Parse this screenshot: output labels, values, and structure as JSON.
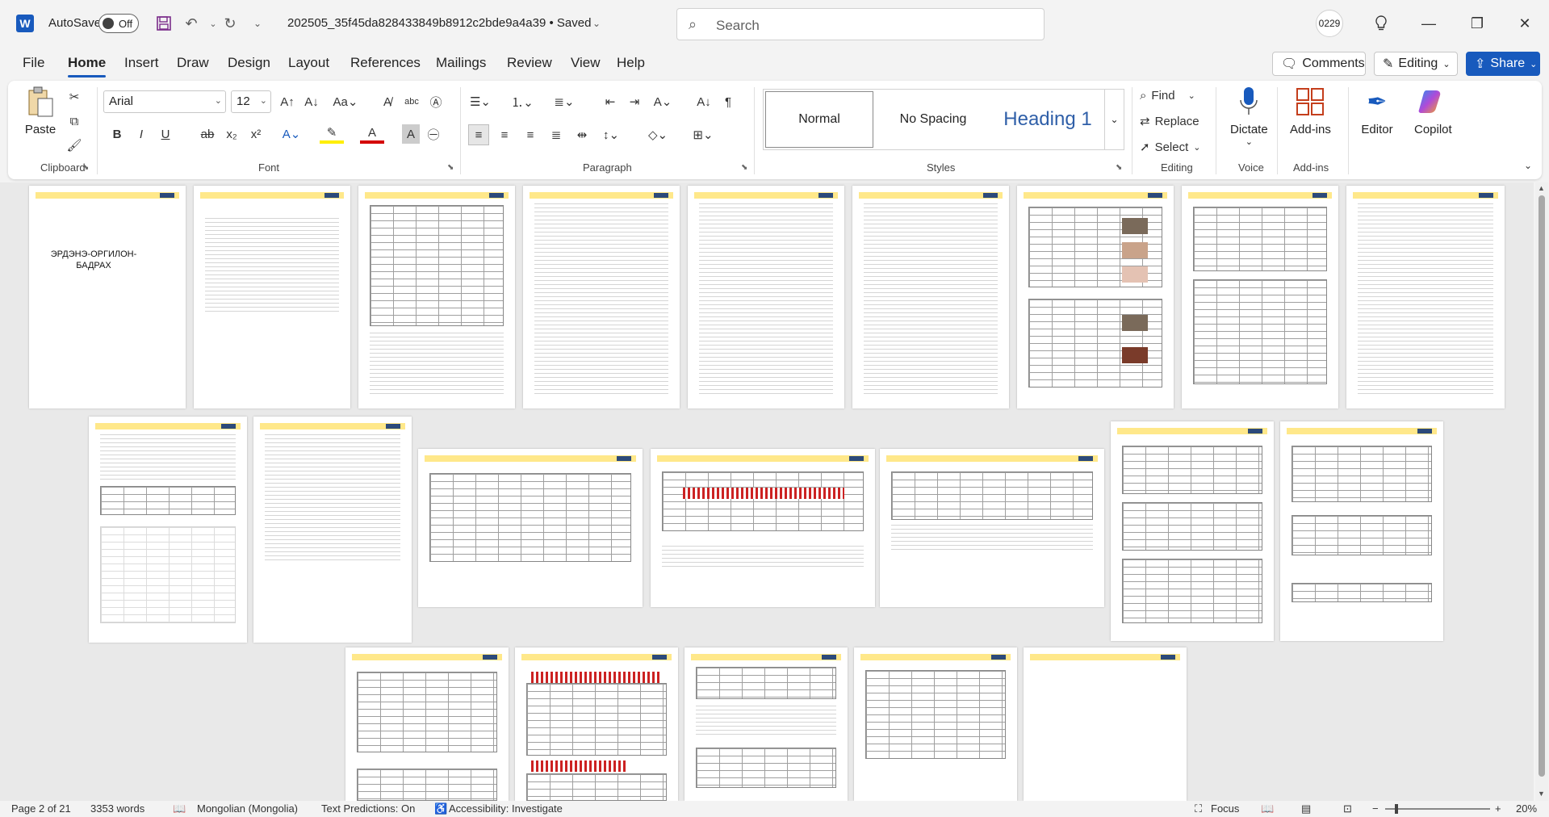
{
  "titlebar": {
    "autosave_label": "AutoSave",
    "autosave_state": "Off",
    "doc_title": "202505_35f45da828433849b8912c2bde9a4a39 • Saved",
    "search_placeholder": "Search",
    "user_initials": "0229"
  },
  "tabs": [
    "File",
    "Home",
    "Insert",
    "Draw",
    "Design",
    "Layout",
    "References",
    "Mailings",
    "Review",
    "View",
    "Help"
  ],
  "active_tab": "Home",
  "right_buttons": {
    "comments": "Comments",
    "editing": "Editing",
    "share": "Share"
  },
  "ribbon": {
    "clipboard": {
      "paste": "Paste",
      "label": "Clipboard"
    },
    "font": {
      "name": "Arial",
      "size": "12",
      "label": "Font"
    },
    "paragraph": {
      "label": "Paragraph"
    },
    "styles": {
      "items": [
        "Normal",
        "No Spacing",
        "Heading 1"
      ],
      "label": "Styles"
    },
    "editing": {
      "find": "Find",
      "replace": "Replace",
      "select": "Select",
      "label": "Editing"
    },
    "voice": {
      "dictate": "Dictate",
      "label": "Voice"
    },
    "addins": {
      "addins": "Add-ins",
      "label": "Add-ins"
    },
    "editor": "Editor",
    "copilot": "Copilot"
  },
  "document": {
    "cover_title": "ЭРДЭНЭ-ОРГИЛОН-БАДРАХ"
  },
  "statusbar": {
    "page": "Page 2 of 21",
    "words": "3353 words",
    "language": "Mongolian (Mongolia)",
    "predictions": "Text Predictions: On",
    "accessibility": "Accessibility: Investigate",
    "focus": "Focus",
    "zoom": "20%"
  },
  "colors": {
    "accent": "#185abd",
    "header_band": "#ffe88a"
  }
}
